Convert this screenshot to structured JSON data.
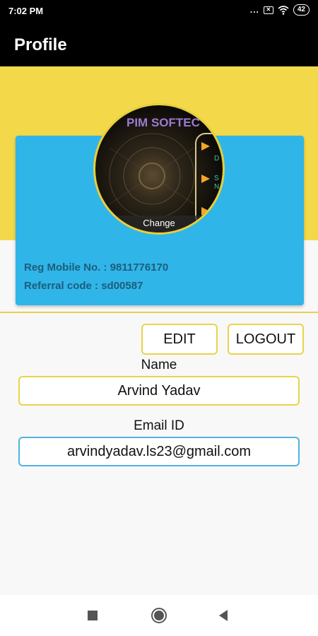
{
  "status_bar": {
    "time": "7:02 PM",
    "dots": "...",
    "battery": "42",
    "icons": [
      "close-box-icon",
      "wifi-icon",
      "battery-icon"
    ]
  },
  "app_bar": {
    "title": "Profile"
  },
  "profile_card": {
    "reg_mobile": "Reg Mobile No. : 9811776170",
    "referral_code": "Referral code : sd00587",
    "avatar_change_label": "Change",
    "avatar_logo_text": "PIM SOFTEC"
  },
  "actions": {
    "edit_label": "EDIT",
    "logout_label": "LOGOUT"
  },
  "form": {
    "name_label": "Name",
    "name_value": "Arvind Yadav",
    "email_label": "Email ID",
    "email_value": "arvindyadav.ls23@gmail.com"
  },
  "colors": {
    "accent_yellow": "#f3d94a",
    "card_blue": "#30b5e8",
    "card_text": "#1c5d7c",
    "email_border": "#4fb3df"
  },
  "nav_bar": {
    "icons": [
      "recent-apps-icon",
      "home-icon",
      "back-icon"
    ]
  }
}
